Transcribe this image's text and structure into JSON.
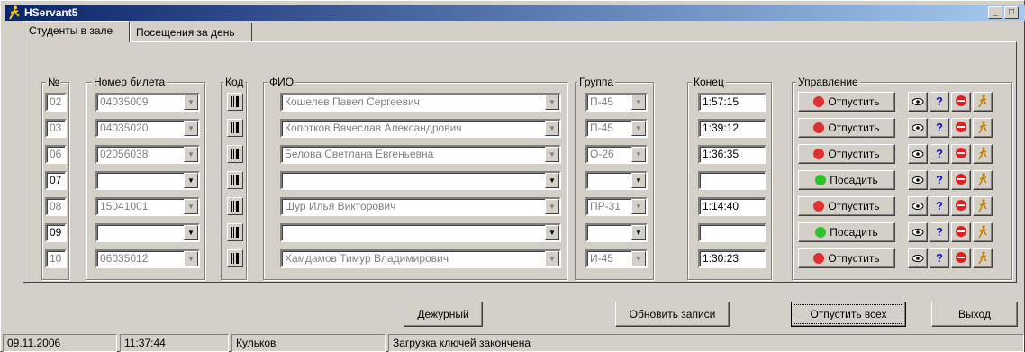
{
  "window": {
    "title": "HServant5"
  },
  "tabs": [
    "Студенты в зале",
    "Посещения за день"
  ],
  "columns": {
    "num": "№",
    "ticket": "Номер билета",
    "code": "Код",
    "fio": "ФИО",
    "group": "Группа",
    "end": "Конец",
    "control": "Управление"
  },
  "rows": [
    {
      "num": "02",
      "ticket": "04035009",
      "fio": "Кошелев Павел Сергеевич",
      "group": "П-45",
      "end": "1:57:15",
      "action": "Отпустить",
      "active": true
    },
    {
      "num": "03",
      "ticket": "04035020",
      "fio": "Копотков Вячеслав Александрович",
      "group": "П-45",
      "end": "1:39:12",
      "action": "Отпустить",
      "active": true
    },
    {
      "num": "06",
      "ticket": "02056038",
      "fio": "Белова Светлана Евгеньевна",
      "group": "О-26",
      "end": "1:36:35",
      "action": "Отпустить",
      "active": true
    },
    {
      "num": "07",
      "ticket": "",
      "fio": "",
      "group": "",
      "end": "",
      "action": "Посадить",
      "active": false
    },
    {
      "num": "08",
      "ticket": "15041001",
      "fio": "Шур Илья Викторович",
      "group": "ПР-31",
      "end": "1:14:40",
      "action": "Отпустить",
      "active": true
    },
    {
      "num": "09",
      "ticket": "",
      "fio": "",
      "group": "",
      "end": "",
      "action": "Посадить",
      "active": false
    },
    {
      "num": "10",
      "ticket": "06035012",
      "fio": "Хамдамов Тимур Владимирович",
      "group": "И-45",
      "end": "1:30:23",
      "action": "Отпустить",
      "active": true
    }
  ],
  "icons": {
    "view": "eye-icon",
    "help": "?",
    "stop": "no-entry-icon",
    "walk": "walking-person-icon"
  },
  "colors": {
    "release": "#e03030",
    "seat": "#30c030",
    "title_start": "#0a246a",
    "title_end": "#a6caf0"
  },
  "buttons": {
    "duty": "Дежурный",
    "refresh": "Обновить записи",
    "release_all": "Отпустить всех",
    "exit": "Выход"
  },
  "status": {
    "date": "09.11.2006",
    "time": "11:37:44",
    "user": "Кульков",
    "message": "Загрузка ключей закончена"
  }
}
